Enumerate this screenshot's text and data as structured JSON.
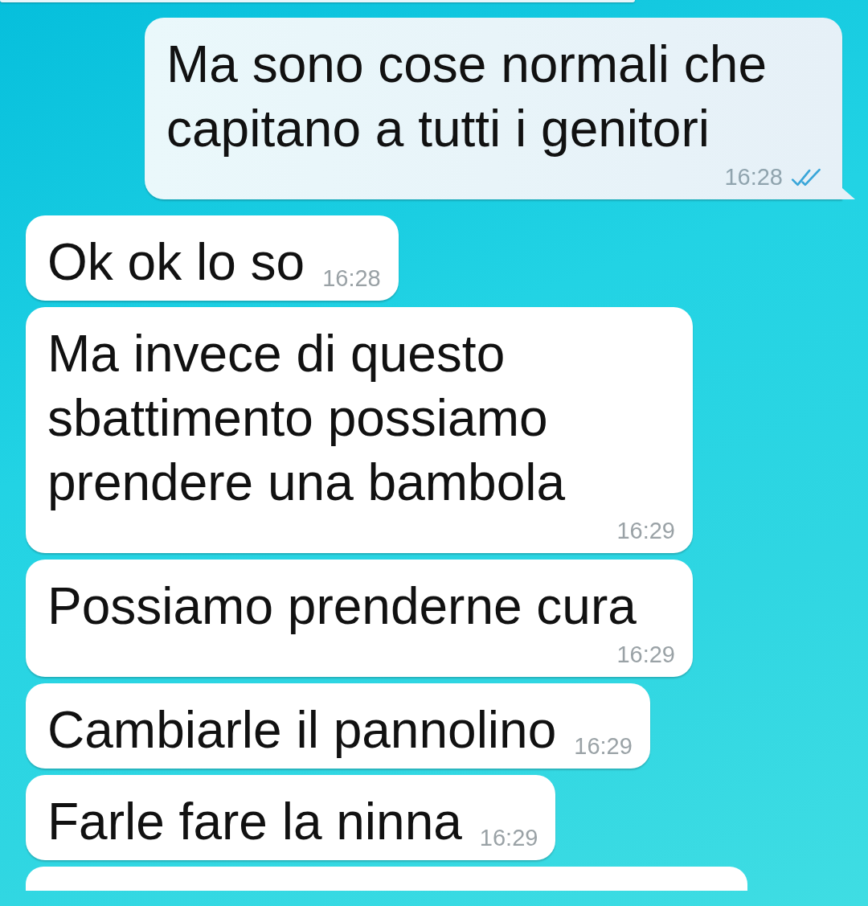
{
  "messages": [
    {
      "kind": "outgoing",
      "text": "Ma sono cose normali che capitano a tutti i genitori",
      "time": "16:28",
      "read": true
    },
    {
      "kind": "incoming",
      "text": "Ok ok lo so",
      "time": "16:28"
    },
    {
      "kind": "incoming",
      "text": "Ma invece di questo sbattimento possiamo prendere una bambola",
      "time": "16:29"
    },
    {
      "kind": "incoming",
      "text": "Possiamo prenderne cura",
      "time": "16:29"
    },
    {
      "kind": "incoming",
      "text": "Cambiarle il pannolino",
      "time": "16:29"
    },
    {
      "kind": "incoming",
      "text": "Farle fare la ninna",
      "time": "16:29"
    }
  ]
}
